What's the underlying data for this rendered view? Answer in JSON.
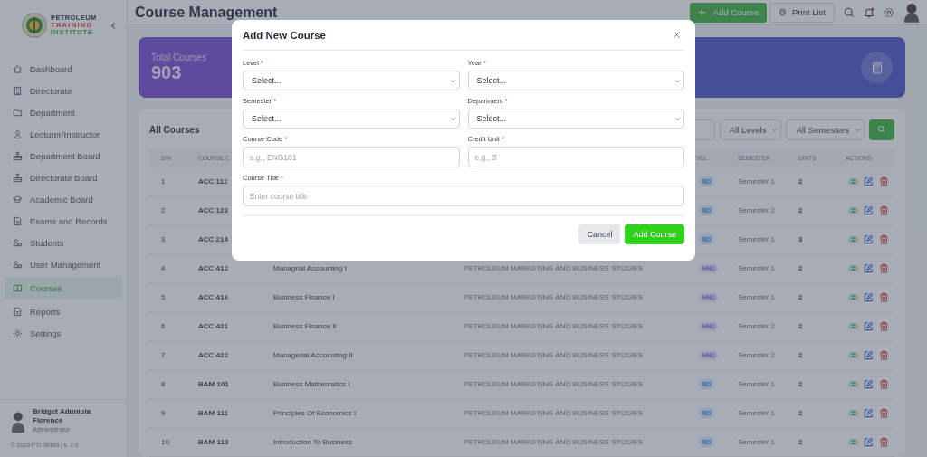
{
  "logo": {
    "lines": [
      "PETROLEUM",
      "TRAINING",
      "INSTITUTE"
    ]
  },
  "sidebar": {
    "items": [
      {
        "label": "Dashboard",
        "selected": false
      },
      {
        "label": "Directorate",
        "selected": false
      },
      {
        "label": "Department",
        "selected": false
      },
      {
        "label": "Lecturer/Instructor",
        "selected": false
      },
      {
        "label": "Department Board",
        "selected": false
      },
      {
        "label": "Directorate Board",
        "selected": false
      },
      {
        "label": "Academic Board",
        "selected": false
      },
      {
        "label": "Exams and Records",
        "selected": false
      },
      {
        "label": "Students",
        "selected": false
      },
      {
        "label": "User Management",
        "selected": false
      },
      {
        "label": "Courses",
        "selected": true
      },
      {
        "label": "Reports",
        "selected": false
      },
      {
        "label": "Settings",
        "selected": false
      }
    ],
    "user": {
      "name": "Bridget Aduniola Florence",
      "role": "Administrator"
    },
    "footer": "© 2026 PTI SRMS | v. 2.0"
  },
  "header": {
    "title": "Course Management",
    "add_button": "Add Course",
    "print_button": "Print List",
    "notification_dot": true
  },
  "stats": [
    {
      "label": "Total Courses",
      "value": "903"
    }
  ],
  "table": {
    "title": "All Courses",
    "filters": [
      "All Levels",
      "All Semesters"
    ],
    "columns": [
      {
        "label": "S/N"
      },
      {
        "label": "COURSE C"
      },
      {},
      {},
      {
        "label": "VEL"
      },
      {
        "label": "SEMESTER"
      },
      {
        "label": "UNITS"
      },
      {
        "label": "ACTIONS"
      }
    ],
    "rows": [
      {
        "sn": "1",
        "code": "ACC 112",
        "level": {
          "text": "ND",
          "kind": "nd"
        },
        "semester": "Semester 1",
        "units": "2"
      },
      {
        "sn": "2",
        "code": "ACC 123",
        "level": {
          "text": "ND",
          "kind": "nd"
        },
        "semester": "Semester 2",
        "units": "2"
      },
      {
        "sn": "3",
        "code": "ACC 214",
        "level": {
          "text": "ND",
          "kind": "nd"
        },
        "semester": "Semester 1",
        "units": "3"
      },
      {
        "sn": "4",
        "code": "ACC 412",
        "title": "Managrial Accounting I",
        "department": "PETROLEUM MARKETING AND BUSINESS STUDIES",
        "level": {
          "text": "HND",
          "kind": "hnd"
        },
        "semester": "Semester 1",
        "units": "2"
      },
      {
        "sn": "5",
        "code": "ACC 416",
        "title": "Business Finance I",
        "department": "PETROLEUM MARKETING AND BUSINESS STUDIES",
        "level": {
          "text": "HND",
          "kind": "hnd"
        },
        "semester": "Semester 1",
        "units": "2"
      },
      {
        "sn": "6",
        "code": "ACC 421",
        "title": "Business Finance II",
        "department": "PETROLEUM MARKETING AND BUSINESS STUDIES",
        "level": {
          "text": "HND",
          "kind": "hnd"
        },
        "semester": "Semester 2",
        "units": "2"
      },
      {
        "sn": "7",
        "code": "ACC 422",
        "title": "Managerial Accounting II",
        "department": "PETROLEUM MARKETING AND BUSINESS STUDIES",
        "level": {
          "text": "HND",
          "kind": "hnd"
        },
        "semester": "Semester 2",
        "units": "2"
      },
      {
        "sn": "8",
        "code": "BAM 101",
        "title": "Business Mathematics I",
        "department": "PETROLEUM MARKETING AND BUSINESS STUDIES",
        "level": {
          "text": "ND",
          "kind": "nd"
        },
        "semester": "Semester 1",
        "units": "2"
      },
      {
        "sn": "9",
        "code": "BAM 111",
        "title": "Principles Of Economics I",
        "department": "PETROLEUM MARKETING AND BUSINESS STUDIES",
        "level": {
          "text": "ND",
          "kind": "nd"
        },
        "semester": "Semester 1",
        "units": "2"
      },
      {
        "sn": "10",
        "code": "BAM 113",
        "title": "Introduction To Business",
        "department": "PETROLEUM MARKETING AND BUSINESS STUDIES",
        "level": {
          "text": "ND",
          "kind": "nd"
        },
        "semester": "Semester 1",
        "units": "2"
      }
    ]
  },
  "modal": {
    "title": "Add New Course",
    "fields": [
      {
        "label": "Level",
        "marker": "*",
        "kind": "select",
        "value": "Select..."
      },
      {
        "label": "Year",
        "marker": "*",
        "kind": "select",
        "value": "Select..."
      },
      {
        "label": "Semester",
        "marker": "*",
        "kind": "select",
        "value": "Select..."
      },
      {
        "label": "Department",
        "marker": "*",
        "kind": "select",
        "value": "Select..."
      },
      {
        "label": "Course Code",
        "marker": "*",
        "kind": "input",
        "placeholder": "e.g., ENG101"
      },
      {
        "label": "Credit Unit",
        "marker": "*",
        "kind": "input",
        "placeholder": "e.g., 3"
      },
      {
        "label": "Course Title",
        "marker": "*",
        "kind": "wide-input",
        "placeholder": "Enter course title"
      }
    ],
    "buttons": [
      {
        "label": "Cancel",
        "kind": "secondary"
      },
      {
        "label": "Add Course",
        "kind": "primary"
      }
    ]
  }
}
